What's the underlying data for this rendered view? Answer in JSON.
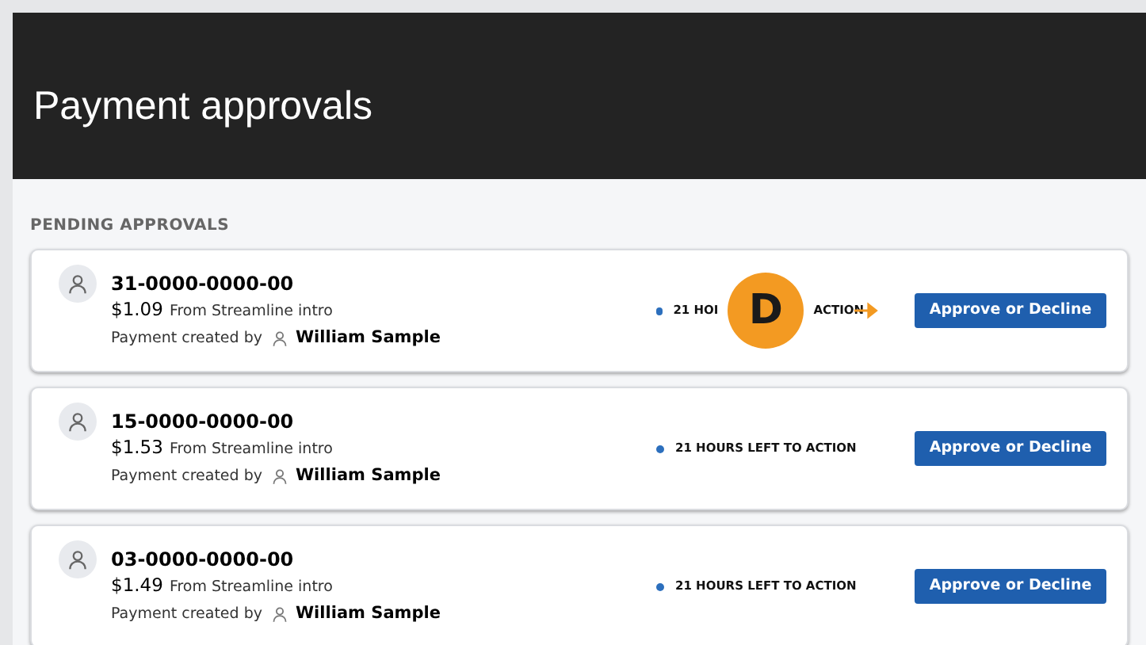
{
  "header": {
    "title": "Payment approvals"
  },
  "section_label": "PENDING APPROVALS",
  "approvals": [
    {
      "account": "31-0000-0000-00",
      "amount": "$1.09",
      "source": "From Streamline intro",
      "created_by_label": "Payment created by",
      "creator": "William Sample",
      "status": [
        "21 HOI",
        "ACTION"
      ],
      "button": "Approve or Decline",
      "callout": "D"
    },
    {
      "account": "15-0000-0000-00",
      "amount": "$1.53",
      "source": "From Streamline intro",
      "created_by_label": "Payment created by",
      "creator": "William Sample",
      "status": [
        "21 HOURS LEFT TO ACTION"
      ],
      "button": "Approve or Decline"
    },
    {
      "account": "03-0000-0000-00",
      "amount": "$1.49",
      "source": "From Streamline intro",
      "created_by_label": "Payment created by",
      "creator": "William Sample",
      "status": [
        "21 HOURS LEFT TO ACTION"
      ],
      "button": "Approve or Decline"
    }
  ]
}
